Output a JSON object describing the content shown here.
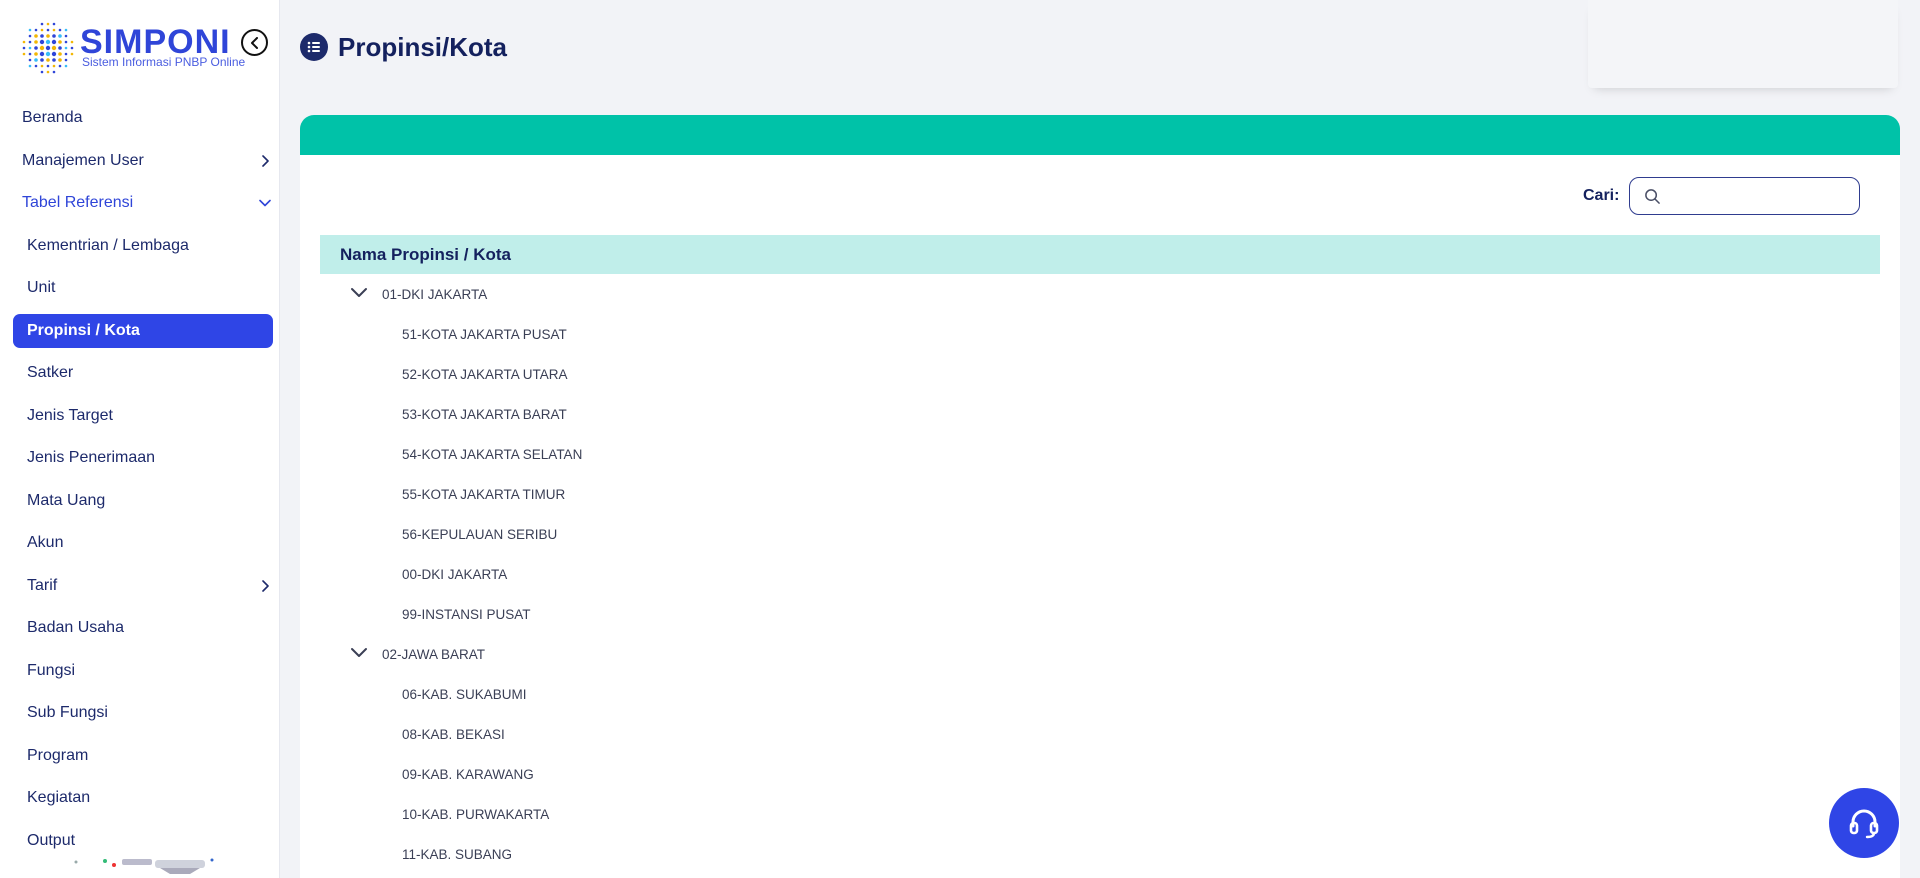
{
  "brand": {
    "name": "SIMPONI",
    "subtitle": "Sistem Informasi PNBP Online"
  },
  "sidebar": {
    "items": [
      {
        "label": "Beranda",
        "type": "top"
      },
      {
        "label": "Manajemen User",
        "type": "top",
        "chevron": "right"
      },
      {
        "label": "Tabel Referensi",
        "type": "top",
        "chevron": "down",
        "open": true
      },
      {
        "label": "Kementrian / Lembaga",
        "type": "sub"
      },
      {
        "label": "Unit",
        "type": "sub"
      },
      {
        "label": "Propinsi / Kota",
        "type": "sub",
        "active": true
      },
      {
        "label": "Satker",
        "type": "sub"
      },
      {
        "label": "Jenis Target",
        "type": "sub"
      },
      {
        "label": "Jenis Penerimaan",
        "type": "sub"
      },
      {
        "label": "Mata Uang",
        "type": "sub"
      },
      {
        "label": "Akun",
        "type": "sub"
      },
      {
        "label": "Tarif",
        "type": "sub",
        "chevron": "right"
      },
      {
        "label": "Badan Usaha",
        "type": "sub"
      },
      {
        "label": "Fungsi",
        "type": "sub"
      },
      {
        "label": "Sub Fungsi",
        "type": "sub"
      },
      {
        "label": "Program",
        "type": "sub"
      },
      {
        "label": "Kegiatan",
        "type": "sub"
      },
      {
        "label": "Output",
        "type": "sub"
      }
    ]
  },
  "header": {
    "title": "Propinsi/Kota",
    "icon": "list-icon"
  },
  "search": {
    "label": "Cari:",
    "value": "",
    "placeholder": ""
  },
  "table": {
    "column": "Nama Propinsi / Kota",
    "rows": [
      {
        "label": "01-DKI JAKARTA",
        "level": 0,
        "expanded": true
      },
      {
        "label": "51-KOTA JAKARTA PUSAT",
        "level": 1
      },
      {
        "label": "52-KOTA JAKARTA UTARA",
        "level": 1
      },
      {
        "label": "53-KOTA JAKARTA BARAT",
        "level": 1
      },
      {
        "label": "54-KOTA JAKARTA SELATAN",
        "level": 1
      },
      {
        "label": "55-KOTA JAKARTA TIMUR",
        "level": 1
      },
      {
        "label": "56-KEPULAUAN SERIBU",
        "level": 1
      },
      {
        "label": "00-DKI JAKARTA",
        "level": 1
      },
      {
        "label": "99-INSTANSI PUSAT",
        "level": 1
      },
      {
        "label": "02-JAWA BARAT",
        "level": 0,
        "expanded": true
      },
      {
        "label": "06-KAB. SUKABUMI",
        "level": 1
      },
      {
        "label": "08-KAB. BEKASI",
        "level": 1
      },
      {
        "label": "09-KAB. KARAWANG",
        "level": 1
      },
      {
        "label": "10-KAB. PURWAKARTA",
        "level": 1
      },
      {
        "label": "11-KAB. SUBANG",
        "level": 1
      }
    ]
  },
  "colors": {
    "accent": "#2f45e6",
    "teal": "#00c2a8",
    "header_row": "#c0eeea",
    "navy": "#14215e"
  },
  "help": {
    "icon": "headset-icon"
  }
}
